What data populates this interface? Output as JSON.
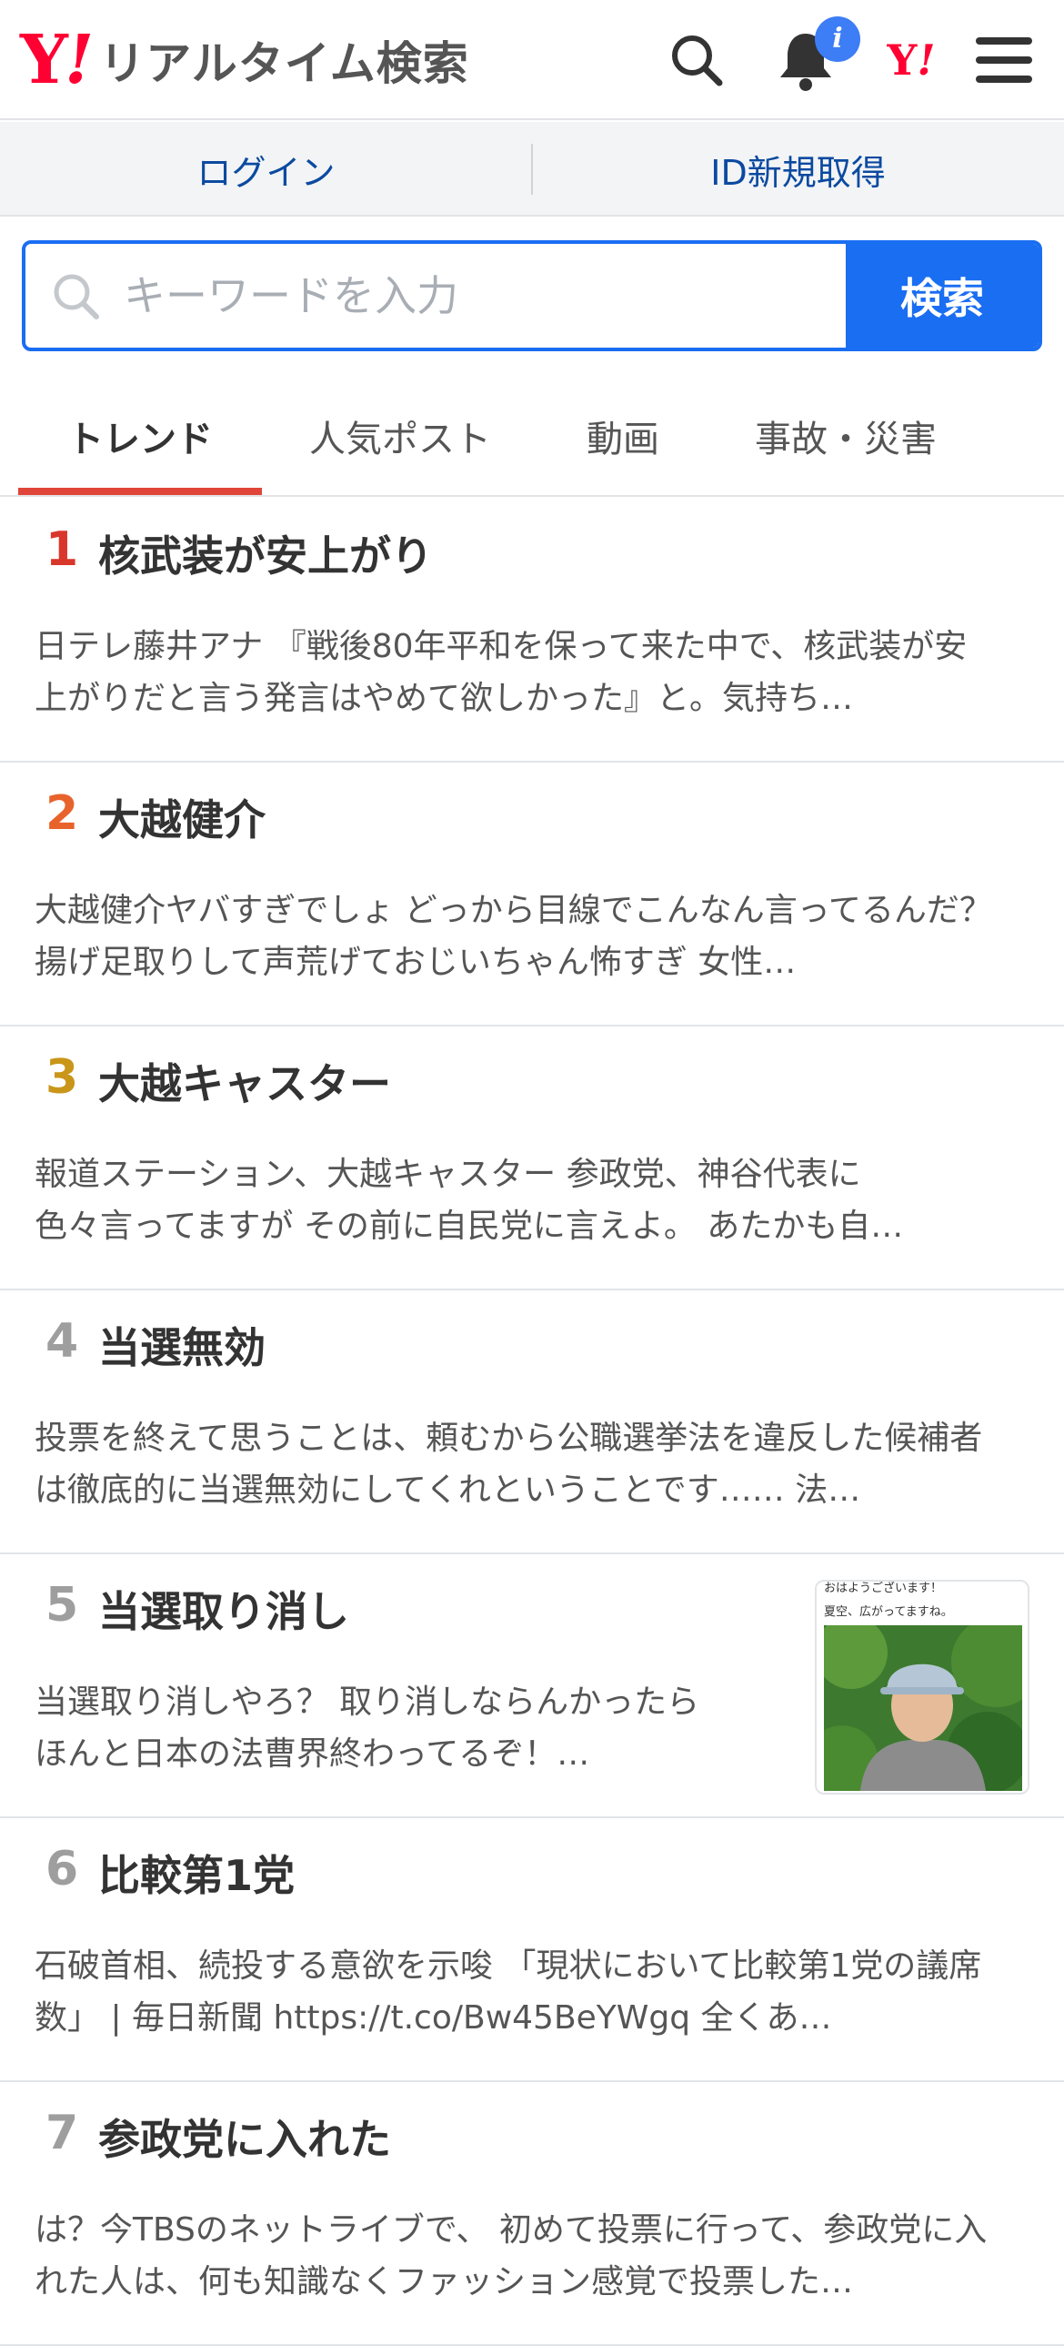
{
  "header": {
    "logo_mark": "Y",
    "logo_bang": "!",
    "logo_text": "リアルタイム検索",
    "notification_badge": "i",
    "yj_mark": "Y",
    "yj_bang": "!"
  },
  "auth": {
    "login": "ログイン",
    "register": "ID新規取得"
  },
  "search": {
    "placeholder": "キーワードを入力",
    "button": "検索"
  },
  "tabs": [
    {
      "label": "トレンド",
      "active": true
    },
    {
      "label": "人気ポスト",
      "active": false
    },
    {
      "label": "動画",
      "active": false
    },
    {
      "label": "事故・災害",
      "active": false
    }
  ],
  "trends": [
    {
      "rank": "1",
      "title": "核武装が安上がり",
      "description": "日テレ藤井アナ 『戦後80年平和を保って来た中で、核武装が安上がりだと言う発言はやめて欲しかった』と。気持ち…",
      "rank_color": "#d9372b"
    },
    {
      "rank": "2",
      "title": "大越健介",
      "description": "大越健介ヤバすぎでしょ どっから目線でこんなん言ってるんだ？ 揚げ足取りして声荒げておじいちゃん怖すぎ 女性…",
      "rank_color": "#e8632c"
    },
    {
      "rank": "3",
      "title": "大越キャスター",
      "description": "報道ステーション、大越キャスター 参政党、神谷代表に\n色々言ってますが その前に自民党に言えよ。 あたかも自…",
      "rank_color": "#c9961a"
    },
    {
      "rank": "4",
      "title": "当選無効",
      "description": "投票を終えて思うことは、頼むから公職選挙法を違反した候補者は徹底的に当選無効にしてくれということです…… 法…",
      "rank_color": "#9e9e9e"
    },
    {
      "rank": "5",
      "title": "当選取り消し",
      "description": "当選取り消しやろ？ 取り消しならんかったら\nほんと日本の法曹界終わってるぞ！…",
      "rank_color": "#9e9e9e",
      "thumbnail": {
        "line1": "おはようございます！",
        "line2": "夏空、広がってますね。"
      }
    },
    {
      "rank": "6",
      "title": "比較第1党",
      "description": "石破首相、続投する意欲を示唆 「現状において比較第1党の議席数」 | 毎日新聞 https://t.co/Bw45BeYWgq 全くあ…",
      "rank_color": "#9e9e9e"
    },
    {
      "rank": "7",
      "title": "参政党に入れた",
      "description": "は？今TBSのネットライブで、 初めて投票に行って、参政党に入れた人は、何も知識なくファッション感覚で投票した…",
      "rank_color": "#9e9e9e"
    }
  ],
  "colors": {
    "brand_red": "#ff0033",
    "accent_blue": "#1a6ef2",
    "link_blue": "#0b4aa0",
    "tab_underline": "#e0453a"
  }
}
